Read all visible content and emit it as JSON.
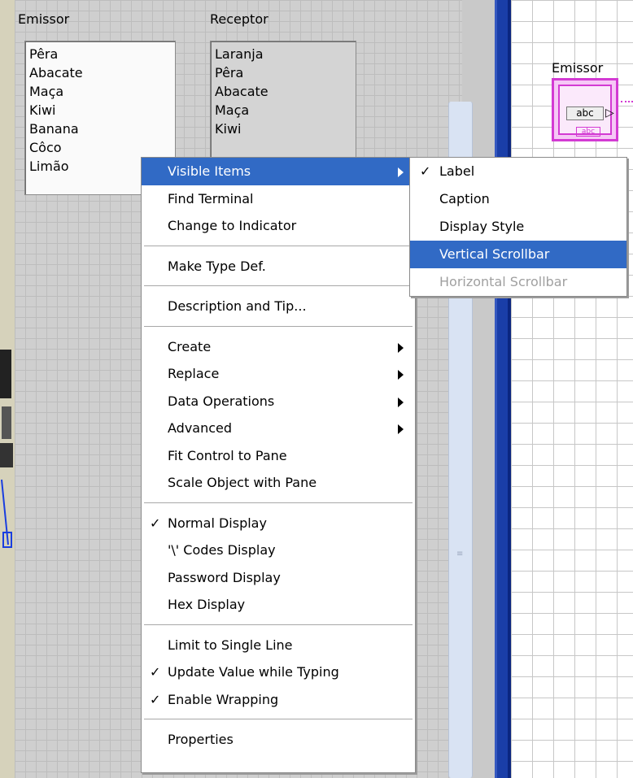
{
  "front_panel": {
    "emissor_label": "Emissor",
    "receptor_label": "Receptor",
    "emissor_items": [
      "Pêra",
      "Abacate",
      "Maça",
      "Kiwi",
      "Banana",
      "Côco",
      "Limão"
    ],
    "receptor_items": [
      "Laranja",
      "Pêra",
      "Abacate",
      "Maça",
      "Kiwi"
    ]
  },
  "block_diagram": {
    "terminal_label": "Emissor",
    "terminal_type": "abc",
    "terminal_subtype": "abc"
  },
  "context_menu": {
    "groups": [
      [
        {
          "label": "Visible Items",
          "submenu": true,
          "highlighted": true
        },
        {
          "label": "Find Terminal"
        },
        {
          "label": "Change to Indicator"
        }
      ],
      [
        {
          "label": "Make Type Def."
        }
      ],
      [
        {
          "label": "Description and Tip..."
        }
      ],
      [
        {
          "label": "Create",
          "submenu": true
        },
        {
          "label": "Replace",
          "submenu": true
        },
        {
          "label": "Data Operations",
          "submenu": true
        },
        {
          "label": "Advanced",
          "submenu": true
        },
        {
          "label": "Fit Control to Pane"
        },
        {
          "label": "Scale Object with Pane"
        }
      ],
      [
        {
          "label": "Normal Display",
          "checked": true
        },
        {
          "label": "'\\' Codes Display"
        },
        {
          "label": "Password Display"
        },
        {
          "label": "Hex Display"
        }
      ],
      [
        {
          "label": "Limit to Single Line"
        },
        {
          "label": "Update Value while Typing",
          "checked": true
        },
        {
          "label": "Enable Wrapping",
          "checked": true
        }
      ],
      [
        {
          "label": "Properties"
        }
      ]
    ]
  },
  "visible_items_submenu": {
    "items": [
      {
        "label": "Label",
        "checked": true
      },
      {
        "label": "Caption"
      },
      {
        "label": "Display Style"
      },
      {
        "label": "Vertical Scrollbar",
        "highlighted": true
      },
      {
        "label": "Horizontal Scrollbar",
        "disabled": true
      }
    ]
  },
  "colors": {
    "highlight": "#316ac5",
    "separator_blue": "#1a3ea8",
    "terminal_pink": "#d33ad3"
  }
}
